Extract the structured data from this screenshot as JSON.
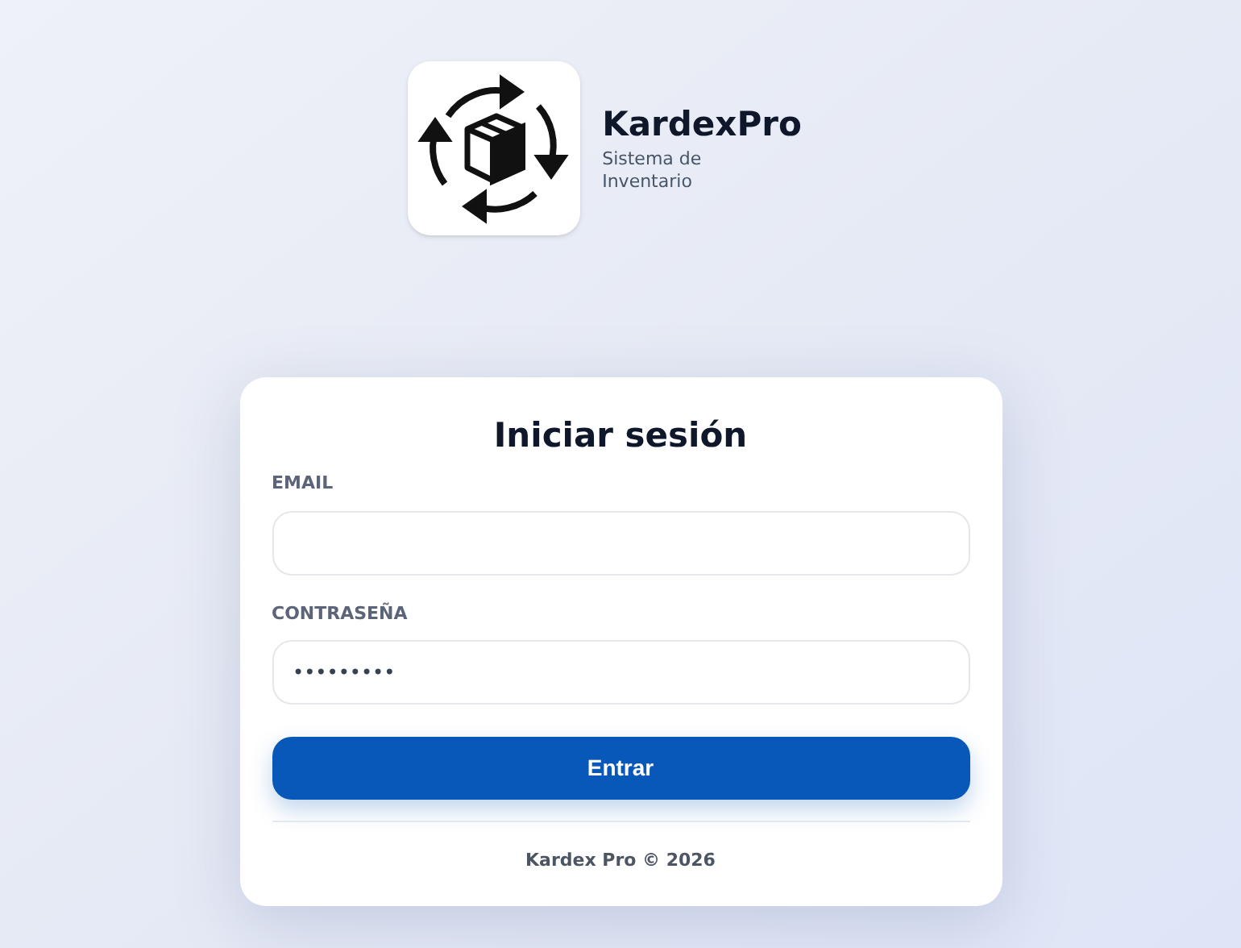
{
  "brand": {
    "name": "KardexPro",
    "subtitle": "Sistema de Inventario"
  },
  "login": {
    "title": "Iniciar sesión",
    "fields": [
      {
        "label": "EMAIL"
      },
      {
        "label": "CONTRASEÑA",
        "value": "•••••••••"
      }
    ],
    "button": "Entrar",
    "footer": "Kardex Pro © 2026"
  }
}
